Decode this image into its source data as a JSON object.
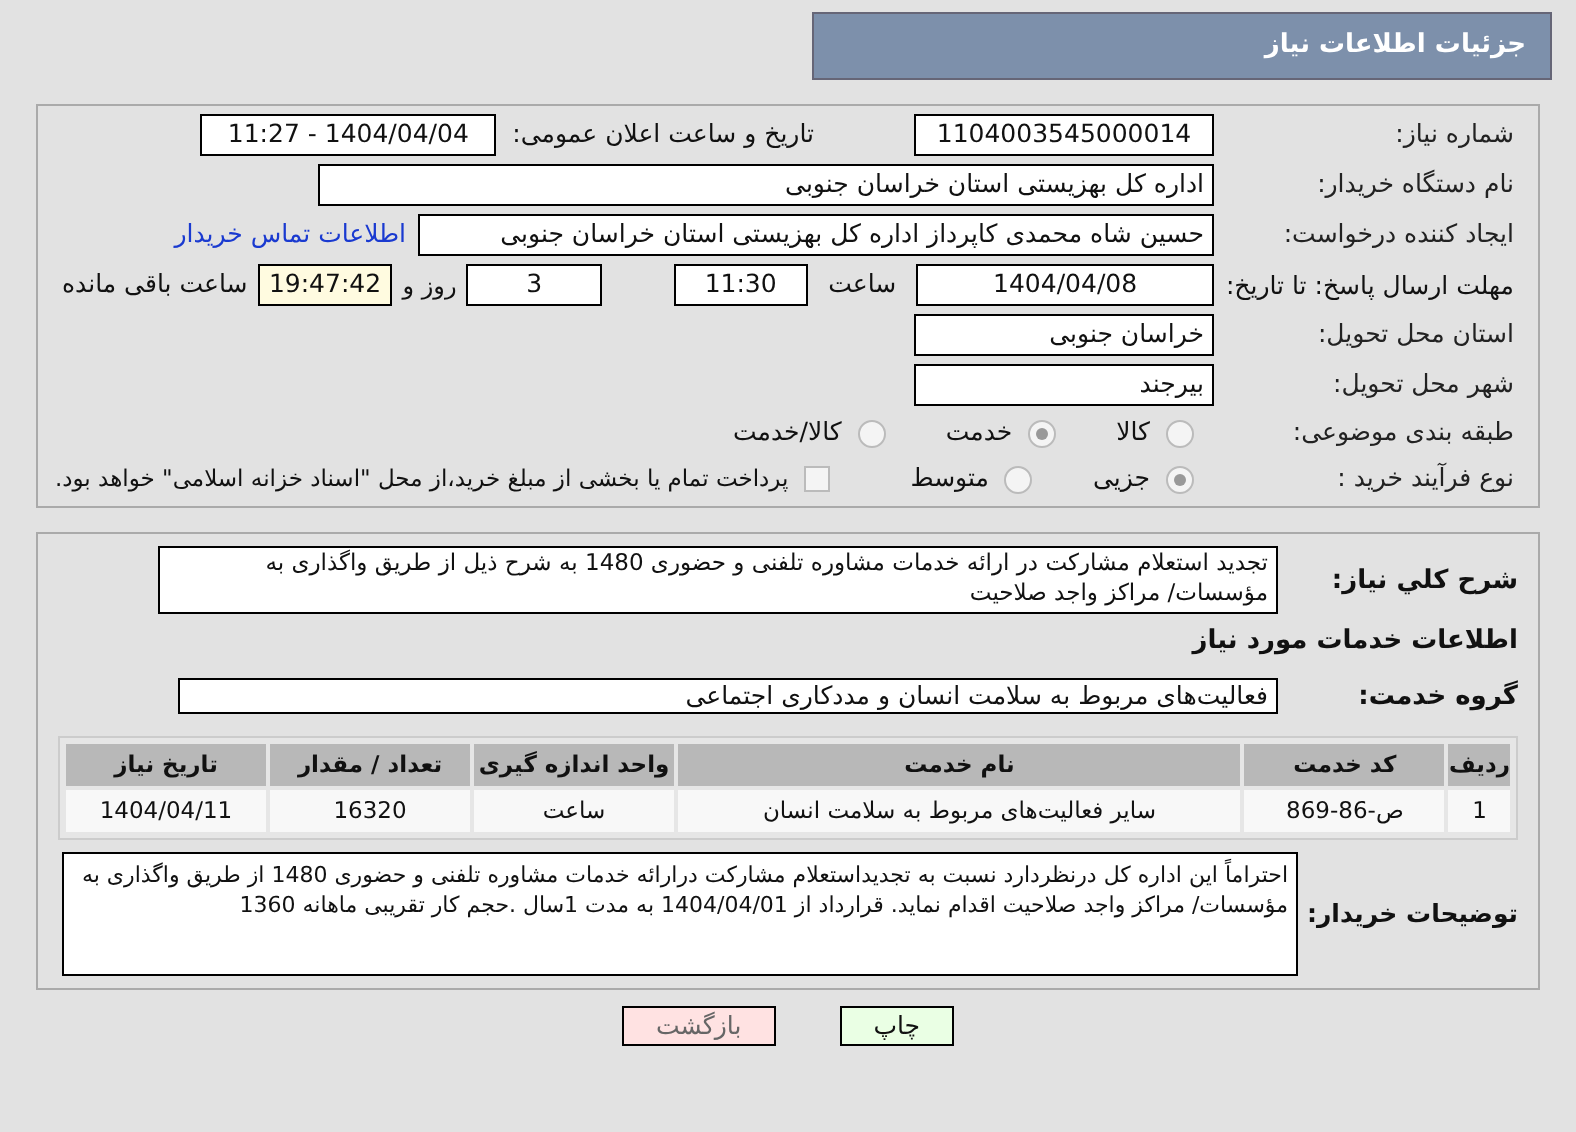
{
  "header": {
    "title": "جزئیات اطلاعات نیاز"
  },
  "details": {
    "need_number": {
      "label": "شماره نیاز:",
      "value": "1104003545000014"
    },
    "announce_date": {
      "label": "تاریخ و ساعت اعلان عمومی:",
      "value": "1404/04/04 - 11:27"
    },
    "buyer_org": {
      "label": "نام دستگاه خریدار:",
      "value": "اداره کل بهزیستی استان خراسان جنوبی"
    },
    "requester": {
      "label": "ایجاد کننده درخواست:",
      "value": "حسین شاه محمدی کاپرداز اداره کل بهزیستی استان خراسان جنوبی",
      "link": "اطلاعات تماس خریدار"
    },
    "deadline": {
      "label": "مهلت ارسال پاسخ: تا تاریخ:",
      "date": "1404/04/08",
      "time_label": "ساعت",
      "time": "11:30",
      "days": "3",
      "days_label": "روز و",
      "remaining": "19:47:42",
      "remaining_label": "ساعت باقی مانده"
    },
    "province": {
      "label": "استان محل تحویل:",
      "value": "خراسان جنوبی"
    },
    "city": {
      "label": "شهر محل تحویل:",
      "value": "بیرجند"
    },
    "category": {
      "label": "طبقه بندی موضوعی:",
      "options": [
        {
          "label": "کالا",
          "selected": false
        },
        {
          "label": "خدمت",
          "selected": true
        },
        {
          "label": "کالا/خدمت",
          "selected": false
        }
      ]
    },
    "process": {
      "label": "نوع فرآیند خرید :",
      "options": [
        {
          "label": "جزیی",
          "selected": true
        },
        {
          "label": "متوسط",
          "selected": false
        }
      ],
      "payment": {
        "label": "پرداخت تمام یا بخشی از مبلغ خرید،از محل \"اسناد خزانه اسلامی\" خواهد بود.",
        "checked": false
      }
    }
  },
  "need": {
    "description_label": "شرح کلي نياز:",
    "description": "تجدید استعلام مشارکت در ارائه خدمات مشاوره تلفنی و حضوری 1480 به شرح ذیل از طریق واگذاری به مؤسسات/ مراکز  واجد صلاحیت",
    "services_title": "اطلاعات خدمات مورد نیاز",
    "group_label": "گروه خدمت:",
    "group": "فعالیت‌های مربوط به سلامت انسان و مددکاری اجتماعی",
    "table": {
      "columns": [
        "ردیف",
        "کد خدمت",
        "نام خدمت",
        "واحد اندازه گیری",
        "تعداد / مقدار",
        "تاریخ نیاز"
      ],
      "rows": [
        [
          "1",
          "ص-86-869",
          "سایر فعالیت‌های مربوط به سلامت انسان",
          "ساعت",
          "16320",
          "1404/04/11"
        ]
      ]
    },
    "notes_label": "توضیحات خریدار:",
    "notes": "احتراماً این اداره کل درنظردارد نسبت به تجدیداستعلام مشارکت درارائه خدمات مشاوره تلفنی و حضوری 1480 از طریق واگذاری به مؤسسات/ مراکز واجد صلاحیت اقدام نماید. قرارداد از 1404/04/01 به مدت 1سال .حجم کار تقریبی ماهانه 1360"
  },
  "buttons": [
    {
      "kind": "print",
      "label": "چاپ"
    },
    {
      "kind": "back",
      "label": "بازگشت"
    }
  ]
}
